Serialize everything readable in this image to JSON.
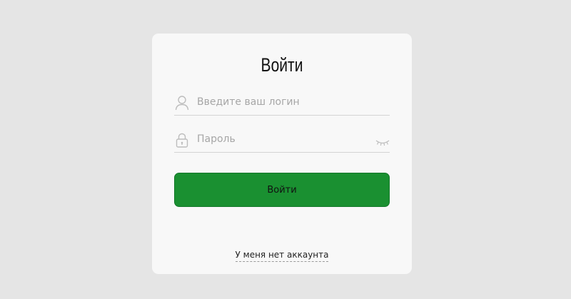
{
  "login_form": {
    "title": "Войти",
    "login_placeholder": "Введите ваш логин",
    "password_placeholder": "Пароль",
    "submit_label": "Войти",
    "register_link": "У меня нет аккаунта",
    "icons": {
      "login": "user-icon",
      "password": "lock-icon",
      "toggle_password": "eye-closed-icon"
    },
    "colors": {
      "submit_background": "#1a9031",
      "page_background": "#e5e5e5",
      "card_background": "#f8f8f8"
    }
  }
}
